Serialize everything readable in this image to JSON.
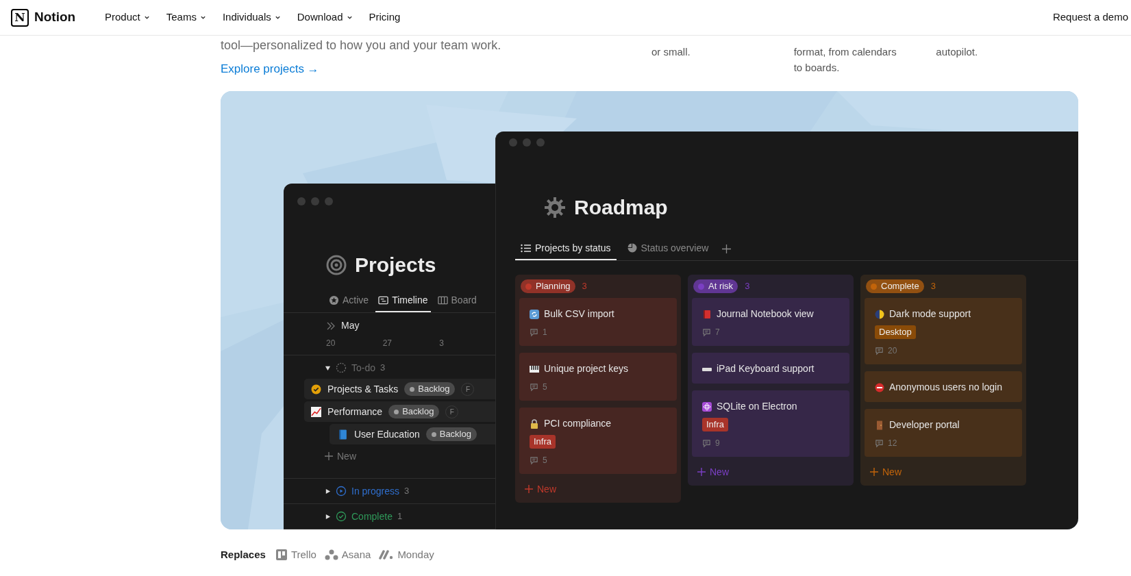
{
  "nav": {
    "logo": {
      "mark": "N",
      "name": "Notion"
    },
    "items": [
      {
        "label": "Product",
        "has_menu": true
      },
      {
        "label": "Teams",
        "has_menu": true
      },
      {
        "label": "Individuals",
        "has_menu": true
      },
      {
        "label": "Download",
        "has_menu": true
      },
      {
        "label": "Pricing",
        "has_menu": false
      }
    ],
    "cta": "Request a demo"
  },
  "hero": {
    "text": "tool—personalized to how you and your team work.",
    "link": "Explore projects →",
    "features": [
      {
        "lines": [
          "or small."
        ]
      },
      {
        "lines": [
          "format, from calendars",
          "to boards."
        ]
      },
      {
        "lines": [
          "autopilot."
        ]
      }
    ]
  },
  "projects_window": {
    "title": "Projects",
    "tabs": [
      {
        "label": "Active",
        "selected": false
      },
      {
        "label": "Timeline",
        "selected": true
      },
      {
        "label": "Board",
        "selected": false
      }
    ],
    "month": "May",
    "dates": [
      "20",
      "27",
      "3"
    ],
    "groups": [
      {
        "label": "To-do",
        "count": "3",
        "color": "#6b6b6b",
        "expanded": true,
        "rows": [
          {
            "title": "Projects & Tasks",
            "status": "Backlog",
            "owner": "F",
            "nested": false
          },
          {
            "title": "Performance",
            "status": "Backlog",
            "owner": "F",
            "nested": false
          },
          {
            "title": "User Education",
            "status": "Backlog",
            "nested": true
          }
        ],
        "new_label": "New"
      },
      {
        "label": "In progress",
        "count": "3",
        "color": "#2f6fce",
        "expanded": false
      },
      {
        "label": "Complete",
        "count": "1",
        "color": "#2f9a5a",
        "expanded": false
      }
    ]
  },
  "roadmap_window": {
    "title": "Roadmap",
    "tabs": [
      {
        "label": "Projects by status",
        "selected": true
      },
      {
        "label": "Status overview",
        "selected": false
      }
    ],
    "columns": [
      {
        "label": "Planning",
        "count": "3",
        "color": "#c0392b",
        "new_label": "New",
        "cards": [
          {
            "title": "Bulk CSV import",
            "comments": "1"
          },
          {
            "title": "Unique project keys",
            "comments": "5"
          },
          {
            "title": "PCI compliance",
            "tag": {
              "label": "Infra",
              "color": "#a8342a"
            },
            "comments": "5"
          }
        ]
      },
      {
        "label": "At risk",
        "count": "3",
        "color": "#7b3fc4",
        "new_label": "New",
        "cards": [
          {
            "title": "Journal Notebook view",
            "comments": "7"
          },
          {
            "title": "iPad Keyboard support"
          },
          {
            "title": "SQLite on Electron",
            "tag": {
              "label": "Infra",
              "color": "#a8342a"
            },
            "comments": "9"
          }
        ]
      },
      {
        "label": "Complete",
        "count": "3",
        "color": "#c2640a",
        "new_label": "New",
        "cards": [
          {
            "title": "Dark mode support",
            "tag": {
              "label": "Desktop",
              "color": "#8a4b08"
            },
            "comments": "20"
          },
          {
            "title": "Anonymous users no login"
          },
          {
            "title": "Developer portal",
            "comments": "12"
          }
        ]
      }
    ]
  },
  "replaces": {
    "label": "Replaces",
    "items": [
      "Trello",
      "Asana",
      "Monday"
    ]
  }
}
